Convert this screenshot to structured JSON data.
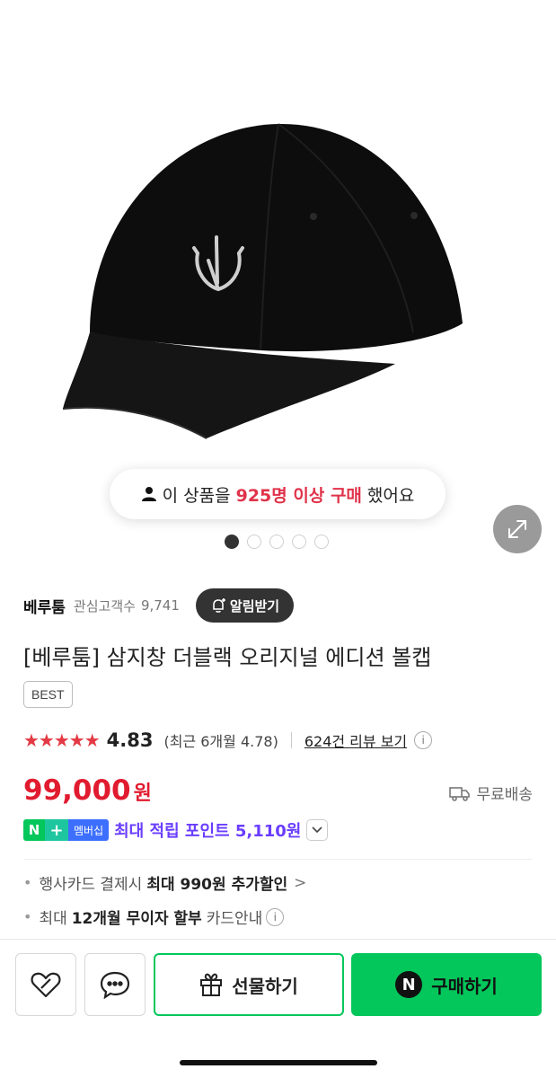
{
  "banner": {
    "prefix": "이 상품을",
    "highlight": "925명 이상 구매",
    "suffix": "했어요"
  },
  "carousel": {
    "total": 5,
    "active": 0
  },
  "store": {
    "name": "베루툼",
    "fav_label": "관심고객수",
    "fav_count": "9,741",
    "alarm_label": "알림받기"
  },
  "product": {
    "title": "[베루툼] 삼지창 더블랙 오리지널 에디션 볼캡",
    "badge": "BEST"
  },
  "rating": {
    "stars": "★★★★★",
    "score": "4.83",
    "recent": "(최근 6개월 4.78)",
    "review_link": "624건 리뷰 보기"
  },
  "price": {
    "amount": "99,000",
    "unit": "원",
    "shipping": "무료배송"
  },
  "points": {
    "n": "N",
    "plus": "+",
    "membership": "멤버십",
    "text": "최대 적립 포인트 5,110원"
  },
  "benefits": [
    {
      "pre": "행사카드 결제시",
      "bold": "최대 990원 추가할인",
      "arrow": ">"
    },
    {
      "pre": "최대",
      "bold": "12개월 무이자 할부",
      "post": "카드안내"
    }
  ],
  "bottom": {
    "gift_label": "선물하기",
    "buy_label": "구매하기",
    "buy_mark": "N"
  },
  "colors": {
    "accent_green": "#03c75a",
    "price_red": "#e11b2f",
    "points_purple": "#6a3dff"
  }
}
